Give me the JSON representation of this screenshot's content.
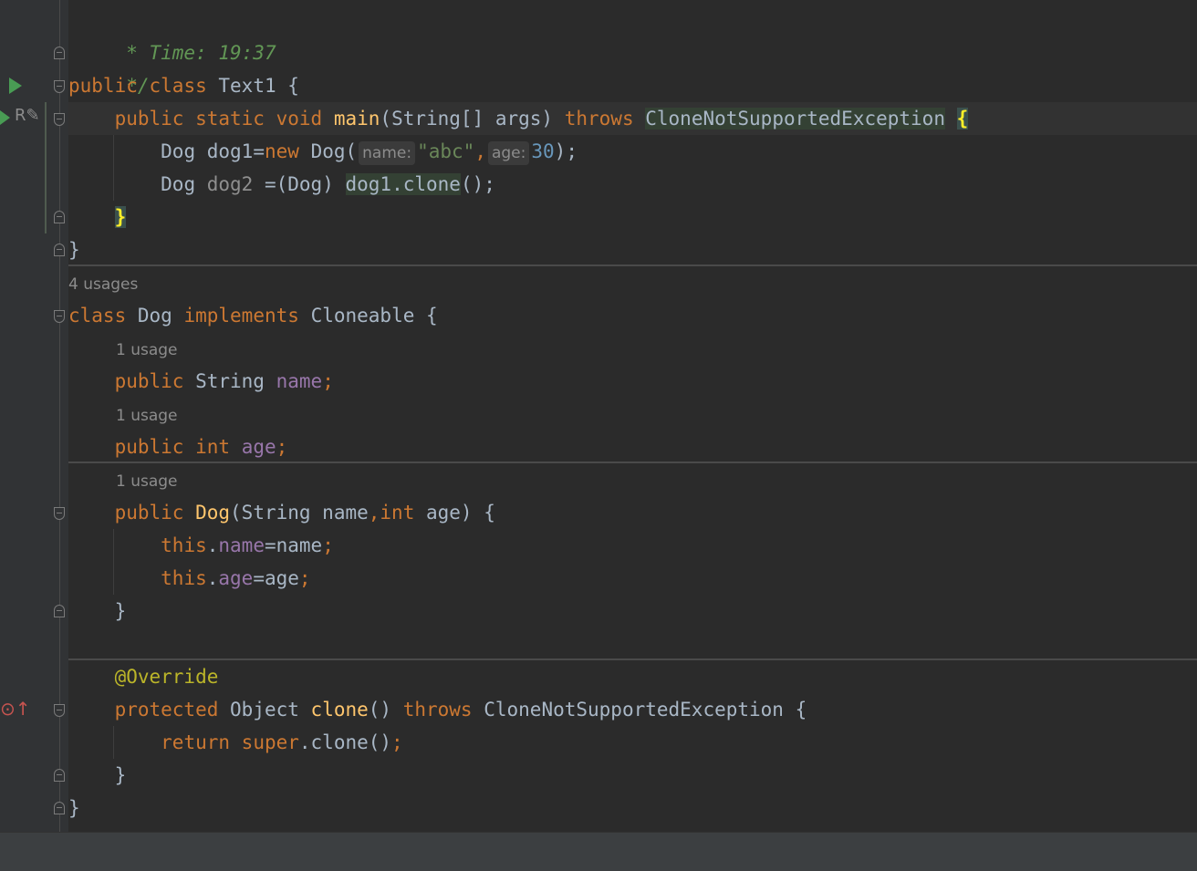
{
  "editor": {
    "comment_time": " * Time: 19:37",
    "comment_end": " */",
    "class_text1": {
      "kw_public": "public",
      "kw_class": "class",
      "name": "Text1",
      "brace": " {"
    },
    "main_method": {
      "kw_public": "public",
      "kw_static": "static",
      "kw_void": "void",
      "name": "main",
      "params": "(String[] args)",
      "kw_throws": "throws",
      "exception": "CloneNotSupportedException",
      "brace": "{"
    },
    "line_dog1": {
      "type": "Dog",
      "decl": "dog1=",
      "kw_new": "new",
      "ctor": "Dog(",
      "hint_name": "name:",
      "str_val": "\"abc\"",
      "comma": ",",
      "hint_age": "age:",
      "num_val": "30",
      "end": ");"
    },
    "line_dog2": {
      "type": "Dog",
      "var": "dog2",
      "cast": "=(Dog)",
      "call": "dog1.clone",
      "end": "();"
    },
    "main_close": "}",
    "class_close": "}",
    "dog_usages": "4 usages",
    "class_dog": {
      "kw_class": "class",
      "name": "Dog",
      "kw_implements": "implements",
      "iface": "Cloneable",
      "brace": "{"
    },
    "usage_name": "1 usage",
    "field_name": {
      "kw_public": "public",
      "type": "String",
      "name": "name",
      "semi": ";"
    },
    "usage_age": "1 usage",
    "field_age": {
      "kw_public": "public",
      "kw_int": "int",
      "name": "age",
      "semi": ";"
    },
    "usage_ctor": "1 usage",
    "ctor": {
      "kw_public": "public",
      "name": "Dog",
      "p1": "(String name",
      "comma": ",",
      "kw_int": "int",
      "p2": " age) {"
    },
    "ctor_line1": {
      "kw_this": "this",
      "dot": ".",
      "field": "name",
      "rest": "=name",
      "semi": ";"
    },
    "ctor_line2": {
      "kw_this": "this",
      "dot": ".",
      "field": "age",
      "rest": "=age",
      "semi": ";"
    },
    "ctor_close": "}",
    "annotation": "@Override",
    "clone_method": {
      "kw_protected": "protected",
      "type": "Object",
      "name": "clone",
      "parens": "()",
      "kw_throws": "throws",
      "exception": "CloneNotSupportedException",
      "brace": "{"
    },
    "return_line": {
      "kw_return": "return",
      "kw_super": "super",
      "rest": ".clone()",
      "semi": ";"
    },
    "clone_close": "}",
    "dog_close": "}"
  },
  "gutter_icons": {
    "run_class": "run-icon",
    "run_main": "run-icon",
    "edit": "edit-icon",
    "override": "override-icon"
  },
  "colors": {
    "background": "#2b2b2b",
    "keyword": "#cc7832",
    "function": "#ffc66d",
    "field": "#9876aa",
    "string": "#6a8759",
    "number": "#6897bb",
    "comment": "#629755",
    "annotation": "#bbb529"
  }
}
